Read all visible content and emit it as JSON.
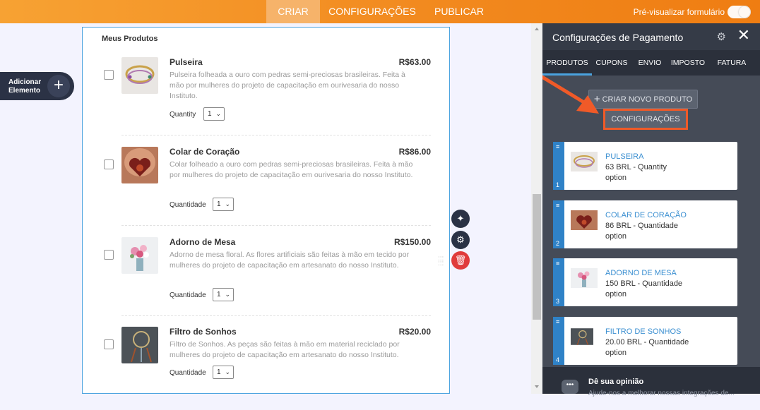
{
  "topbar": {
    "tabs": [
      {
        "label": "CRIAR",
        "active": true
      },
      {
        "label": "CONFIGURAÇÕES",
        "active": false
      },
      {
        "label": "PUBLICAR",
        "active": false
      }
    ],
    "preview_label": "Pré-visualizar formulário",
    "accent_color": "#f28a1f"
  },
  "add_element": {
    "label_line1": "Adicionar",
    "label_line2": "Elemento",
    "icon": "plus-icon"
  },
  "form": {
    "title": "Meus Produtos",
    "products": [
      {
        "name": "Pulseira",
        "price": "R$63.00",
        "description": "Pulseira folheada a ouro com pedras semi-preciosas brasileiras. Feita à mão por mulheres do projeto de capacitação em ourivesaria do nosso Instituto.",
        "qty_label": "Quantity",
        "qty_value": "1"
      },
      {
        "name": "Colar de Coração",
        "price": "R$86.00",
        "description": "Colar folheado a ouro com pedras semi-preciosas brasileiras. Feita à mão por mulheres do projeto de capacitação em ourivesaria do nosso Instituto.",
        "qty_label": "Quantidade",
        "qty_value": "1"
      },
      {
        "name": "Adorno de Mesa",
        "price": "R$150.00",
        "description": "Adorno de mesa floral. As flores artificiais são feitas à mão em tecido por mulheres do projeto de capacitação em artesanato do nosso Instituto.",
        "qty_label": "Quantidade",
        "qty_value": "1"
      },
      {
        "name": "Filtro de Sonhos",
        "price": "R$20.00",
        "description": "Filtro de Sonhos. As peças são feitas à mão em material reciclado por mulheres do projeto de capacitação em artesanato do nosso Instituto.",
        "qty_label": "Quantidade",
        "qty_value": "1"
      }
    ]
  },
  "side_tools": [
    {
      "icon": "magic-wand-icon",
      "color": "#2b3245"
    },
    {
      "icon": "gear-icon",
      "color": "#2b3245"
    },
    {
      "icon": "trash-icon",
      "color": "#e03b3b"
    }
  ],
  "panel": {
    "title": "Configurações de Pagamento",
    "tabs": [
      {
        "label": "PRODUTOS",
        "active": true
      },
      {
        "label": "CUPONS",
        "active": false
      },
      {
        "label": "ENVIO",
        "active": false
      },
      {
        "label": "IMPOSTO",
        "active": false
      },
      {
        "label": "FATURA",
        "active": false
      }
    ],
    "new_product_label": "CRIAR NOVO PRODUTO",
    "settings_label": "CONFIGURAÇÕES",
    "highlight_color": "#f05a28",
    "cards": [
      {
        "index": "1",
        "name": "PULSEIRA",
        "line1": "63 BRL - Quantity",
        "line2": "option"
      },
      {
        "index": "2",
        "name": "COLAR DE CORAÇÃO",
        "line1": "86 BRL - Quantidade",
        "line2": "option"
      },
      {
        "index": "3",
        "name": "ADORNO DE MESA",
        "line1": "150 BRL - Quantidade",
        "line2": "option"
      },
      {
        "index": "4",
        "name": "FILTRO DE SONHOS",
        "line1": "20.00 BRL - Quantidade",
        "line2": "option"
      }
    ],
    "feedback": {
      "title": "Dê sua opinião",
      "subtitle": "Ajude-nos a melhorar nossas integrações de..."
    }
  }
}
